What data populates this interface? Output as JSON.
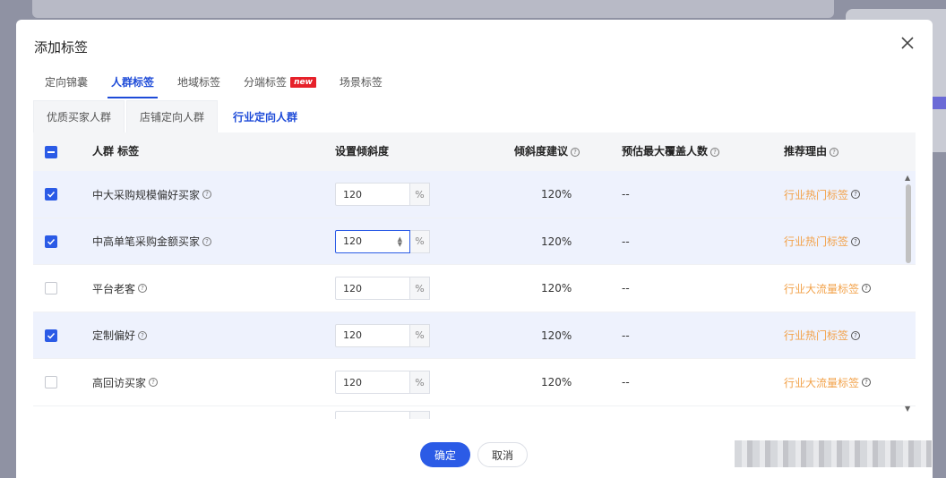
{
  "modal": {
    "title": "添加标签"
  },
  "main_tabs": [
    {
      "label": "定向锦囊",
      "active": false
    },
    {
      "label": "人群标签",
      "active": true
    },
    {
      "label": "地域标签",
      "active": false
    },
    {
      "label": "分端标签",
      "active": false,
      "badge": "new"
    },
    {
      "label": "场景标签",
      "active": false
    }
  ],
  "sub_tabs": [
    {
      "label": "优质买家人群",
      "active": false
    },
    {
      "label": "店铺定向人群",
      "active": false
    },
    {
      "label": "行业定向人群",
      "active": true
    }
  ],
  "table": {
    "headers": {
      "tag": "人群 标签",
      "tilt": "设置倾斜度",
      "suggest": "倾斜度建议",
      "coverage": "预估最大覆盖人数",
      "reason": "推荐理由"
    },
    "unit": "%",
    "rows": [
      {
        "name": "中大采购规模偏好买家",
        "checked": true,
        "value": "120",
        "suggest": "120%",
        "coverage": "--",
        "reason": "行业热门标签"
      },
      {
        "name": "中高单笔采购金额买家",
        "checked": true,
        "value": "120",
        "suggest": "120%",
        "coverage": "--",
        "reason": "行业热门标签"
      },
      {
        "name": "平台老客",
        "checked": false,
        "value": "120",
        "suggest": "120%",
        "coverage": "--",
        "reason": "行业大流量标签"
      },
      {
        "name": "定制偏好",
        "checked": true,
        "value": "120",
        "suggest": "120%",
        "coverage": "--",
        "reason": "行业热门标签"
      },
      {
        "name": "高回访买家",
        "checked": false,
        "value": "120",
        "suggest": "120%",
        "coverage": "--",
        "reason": "行业大流量标签"
      }
    ]
  },
  "footer": {
    "ok_label": "确定",
    "cancel_label": "取消"
  },
  "colors": {
    "primary": "#2b5be6",
    "reason": "#f2a24a",
    "new_badge": "#e6212a",
    "checked_row": "#eef2fd"
  }
}
